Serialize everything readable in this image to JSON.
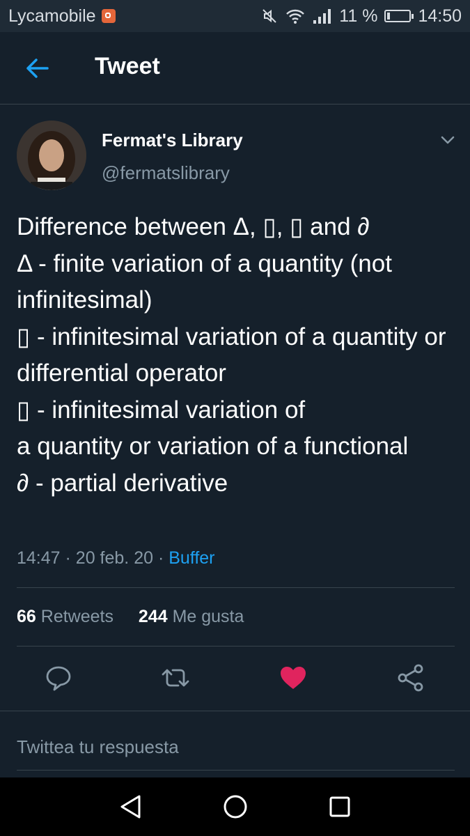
{
  "status_bar": {
    "carrier": "Lycamobile",
    "battery": "11 %",
    "battery_level": 0.11,
    "time": "14:50"
  },
  "header": {
    "title": "Tweet"
  },
  "tweet": {
    "author_name": "Fermat's Library",
    "author_handle": "@fermatslibrary",
    "text": "Difference between Δ, ▯, ▯ and ∂\nΔ - finite variation of a quantity (not infinitesimal)\n▯ - infinitesimal variation of a quantity or differential operator\n▯ - infinitesimal variation of\na quantity or variation of a functional\n∂ - partial derivative",
    "time": "14:47",
    "date": "20 feb. 20",
    "source": "Buffer",
    "retweets_count": "66",
    "retweets_label": "Retweets",
    "likes_count": "244",
    "likes_label": "Me gusta"
  },
  "reply": {
    "placeholder": "Twittea tu respuesta"
  },
  "colors": {
    "background": "#15202b",
    "accent": "#1da1f2",
    "like": "#e0245e",
    "secondary_text": "#8899a6",
    "divider": "#38444d"
  },
  "icons": {
    "back": "arrow-left-icon",
    "more": "chevron-down-icon",
    "reply": "speech-bubble-icon",
    "retweet": "retweet-arrows-icon",
    "like": "heart-icon",
    "share": "share-nodes-icon"
  }
}
